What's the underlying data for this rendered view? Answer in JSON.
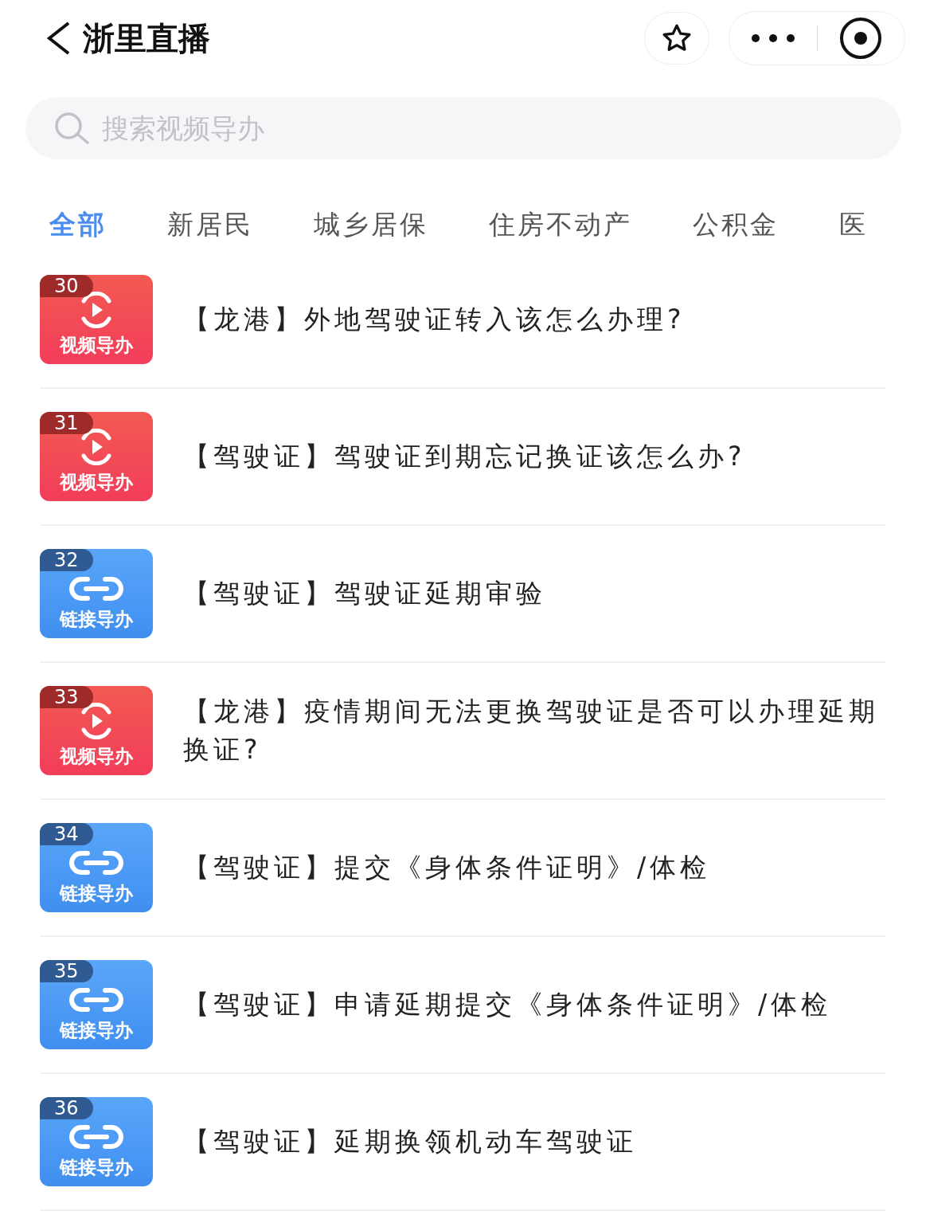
{
  "header": {
    "title": "浙里直播"
  },
  "search": {
    "placeholder": "搜索视频导办"
  },
  "tabs": [
    {
      "label": "全部",
      "selected": true
    },
    {
      "label": "新居民",
      "selected": false
    },
    {
      "label": "城乡居保",
      "selected": false
    },
    {
      "label": "住房不动产",
      "selected": false
    },
    {
      "label": "公积金",
      "selected": false
    },
    {
      "label": "医",
      "selected": false
    }
  ],
  "items": [
    {
      "kind": "video",
      "number": "30",
      "tile_label": "视频导办",
      "title": "【龙港】外地驾驶证转入该怎么办理?"
    },
    {
      "kind": "video",
      "number": "31",
      "tile_label": "视频导办",
      "title": "【驾驶证】驾驶证到期忘记换证该怎么办?"
    },
    {
      "kind": "link",
      "number": "32",
      "tile_label": "链接导办",
      "title": "【驾驶证】驾驶证延期审验"
    },
    {
      "kind": "video",
      "number": "33",
      "tile_label": "视频导办",
      "title": "【龙港】疫情期间无法更换驾驶证是否可以办理延期换证?"
    },
    {
      "kind": "link",
      "number": "34",
      "tile_label": "链接导办",
      "title": "【驾驶证】提交《身体条件证明》/体检"
    },
    {
      "kind": "link",
      "number": "35",
      "tile_label": "链接导办",
      "title": "【驾驶证】申请延期提交《身体条件证明》/体检"
    },
    {
      "kind": "link",
      "number": "36",
      "tile_label": "链接导办",
      "title": "【驾驶证】延期换领机动车驾驶证"
    }
  ]
}
